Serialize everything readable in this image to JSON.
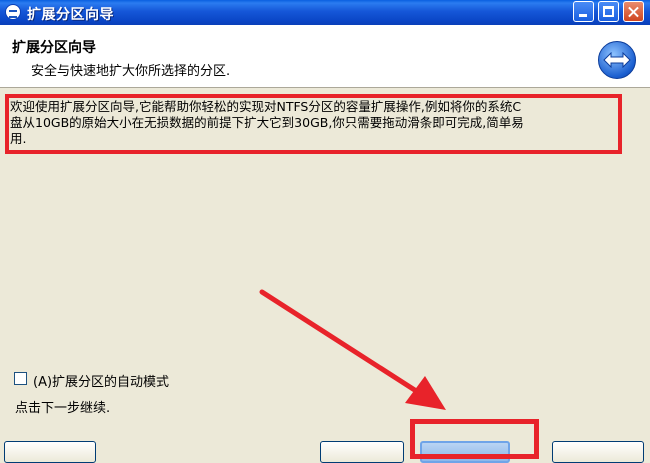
{
  "window": {
    "title": "扩展分区向导"
  },
  "header": {
    "title": "扩展分区向导",
    "subtitle": "安全与快速地扩大你所选择的分区."
  },
  "main": {
    "description_line1": "欢迎使用扩展分区向导,它能帮助你轻松的实现对NTFS分区的容量扩展操作,例如将你的系统C",
    "description_line2": "盘从10GB的原始大小在无损数据的前提下扩大它到30GB,你只需要拖动滑条即可完成,简单易",
    "description_line3": "用."
  },
  "footer": {
    "auto_mode_label": "(A)扩展分区的自动模式",
    "auto_mode_checked": false,
    "hint": "点击下一步继续."
  },
  "colors": {
    "highlight": "#e8232a",
    "titlebar": "#0b47c8",
    "dialog_bg": "#ece9d8"
  }
}
